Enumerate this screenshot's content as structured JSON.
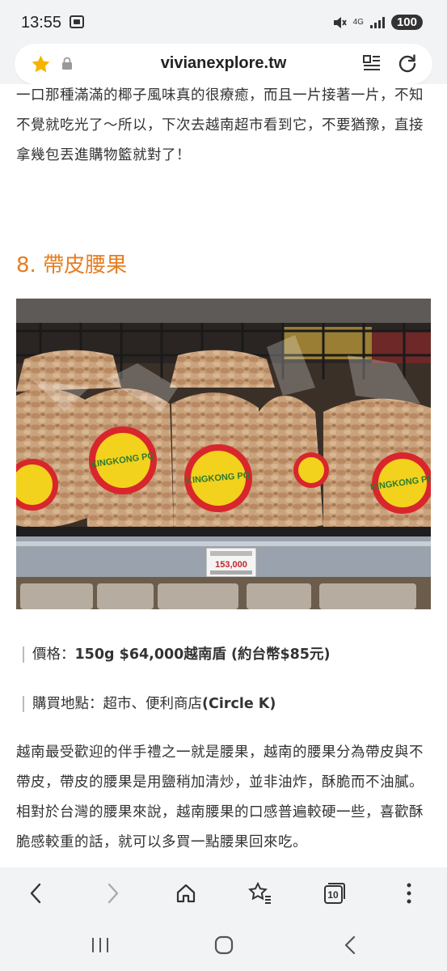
{
  "status_bar": {
    "time": "13:55",
    "network": "4G",
    "battery": "100"
  },
  "browser": {
    "url": "vivianexplore.tw",
    "tabs_count": "10"
  },
  "article": {
    "intro_paragraph": "一口那種滿滿的椰子風味真的很療癒，而且一片接著一片，不知不覺就吃光了～所以，下次去越南超市看到它，不要猶豫，直接拿幾包丟進購物籃就對了！",
    "section_heading": "8. 帶皮腰果",
    "photo": {
      "package_brand": "KINGKONG PQ",
      "price_tag": "153,000"
    },
    "price_label": "價格：",
    "price_value": "150g $64,000越南盾 (約台幣$85元)",
    "where_label": "購買地點：超市、便利商店",
    "where_value": "(Circle K)",
    "body_paragraph": "越南最受歡迎的伴手禮之一就是腰果，越南的腰果分為帶皮與不帶皮，帶皮的腰果是用鹽稍加清炒，並非油炸，酥脆而不油膩。相對於台灣的腰果來說，越南腰果的口感普遍較硬一些，喜歡酥脆感較重的話，就可以多買一點腰果回來吃。"
  },
  "colors": {
    "heading": "#e67e22",
    "star": "#f5b400",
    "chrome_bg": "#f2f3f5"
  }
}
